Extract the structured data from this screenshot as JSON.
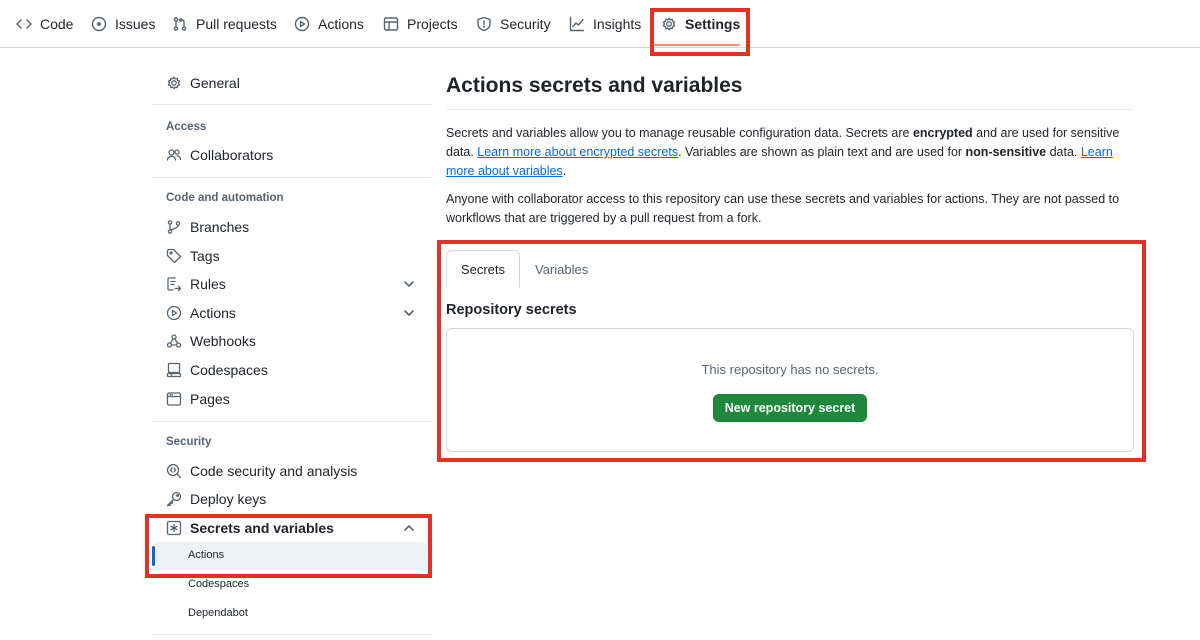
{
  "topnav": {
    "tabs": [
      {
        "label": "Code",
        "icon": "code-icon"
      },
      {
        "label": "Issues",
        "icon": "issue-opened-icon"
      },
      {
        "label": "Pull requests",
        "icon": "git-pull-request-icon"
      },
      {
        "label": "Actions",
        "icon": "play-icon"
      },
      {
        "label": "Projects",
        "icon": "table-icon"
      },
      {
        "label": "Security",
        "icon": "shield-icon"
      },
      {
        "label": "Insights",
        "icon": "graph-icon"
      },
      {
        "label": "Settings",
        "icon": "gear-icon"
      }
    ],
    "active_tab": "Settings"
  },
  "sidebar": {
    "general": "General",
    "access_heading": "Access",
    "collaborators": "Collaborators",
    "code_heading": "Code and automation",
    "branches": "Branches",
    "tags": "Tags",
    "rules": "Rules",
    "actions": "Actions",
    "webhooks": "Webhooks",
    "codespaces": "Codespaces",
    "pages": "Pages",
    "security_heading": "Security",
    "code_security": "Code security and analysis",
    "deploy_keys": "Deploy keys",
    "secrets": "Secrets and variables",
    "sub_items": [
      "Actions",
      "Codespaces",
      "Dependabot"
    ],
    "active_sub_item": "Actions"
  },
  "main": {
    "title": "Actions secrets and variables",
    "p1": {
      "t1": "Secrets and variables allow you to manage reusable configuration data. Secrets are ",
      "b1": "encrypted",
      "t2": " and are used for sensitive data. ",
      "link1": "Learn more about encrypted secrets",
      "t3": ". Variables are shown as plain text and are used for ",
      "b2": "non-sensitive",
      "t4": " data. ",
      "link2": "Learn more about variables",
      "t5": "."
    },
    "p2": "Anyone with collaborator access to this repository can use these secrets and variables for actions. They are not passed to workflows that are triggered by a pull request from a fork.",
    "tabs": [
      "Secrets",
      "Variables"
    ],
    "active_tab": "Secrets",
    "section_title": "Repository secrets",
    "empty_text": "This repository has no secrets.",
    "new_secret_button": "New repository secret"
  },
  "colors": {
    "annotation_red": "#e53124",
    "primary_button": "#1f883d",
    "link": "#0969da",
    "active_tab_underline": "#fd8c73",
    "active_indicator": "#0969da"
  }
}
